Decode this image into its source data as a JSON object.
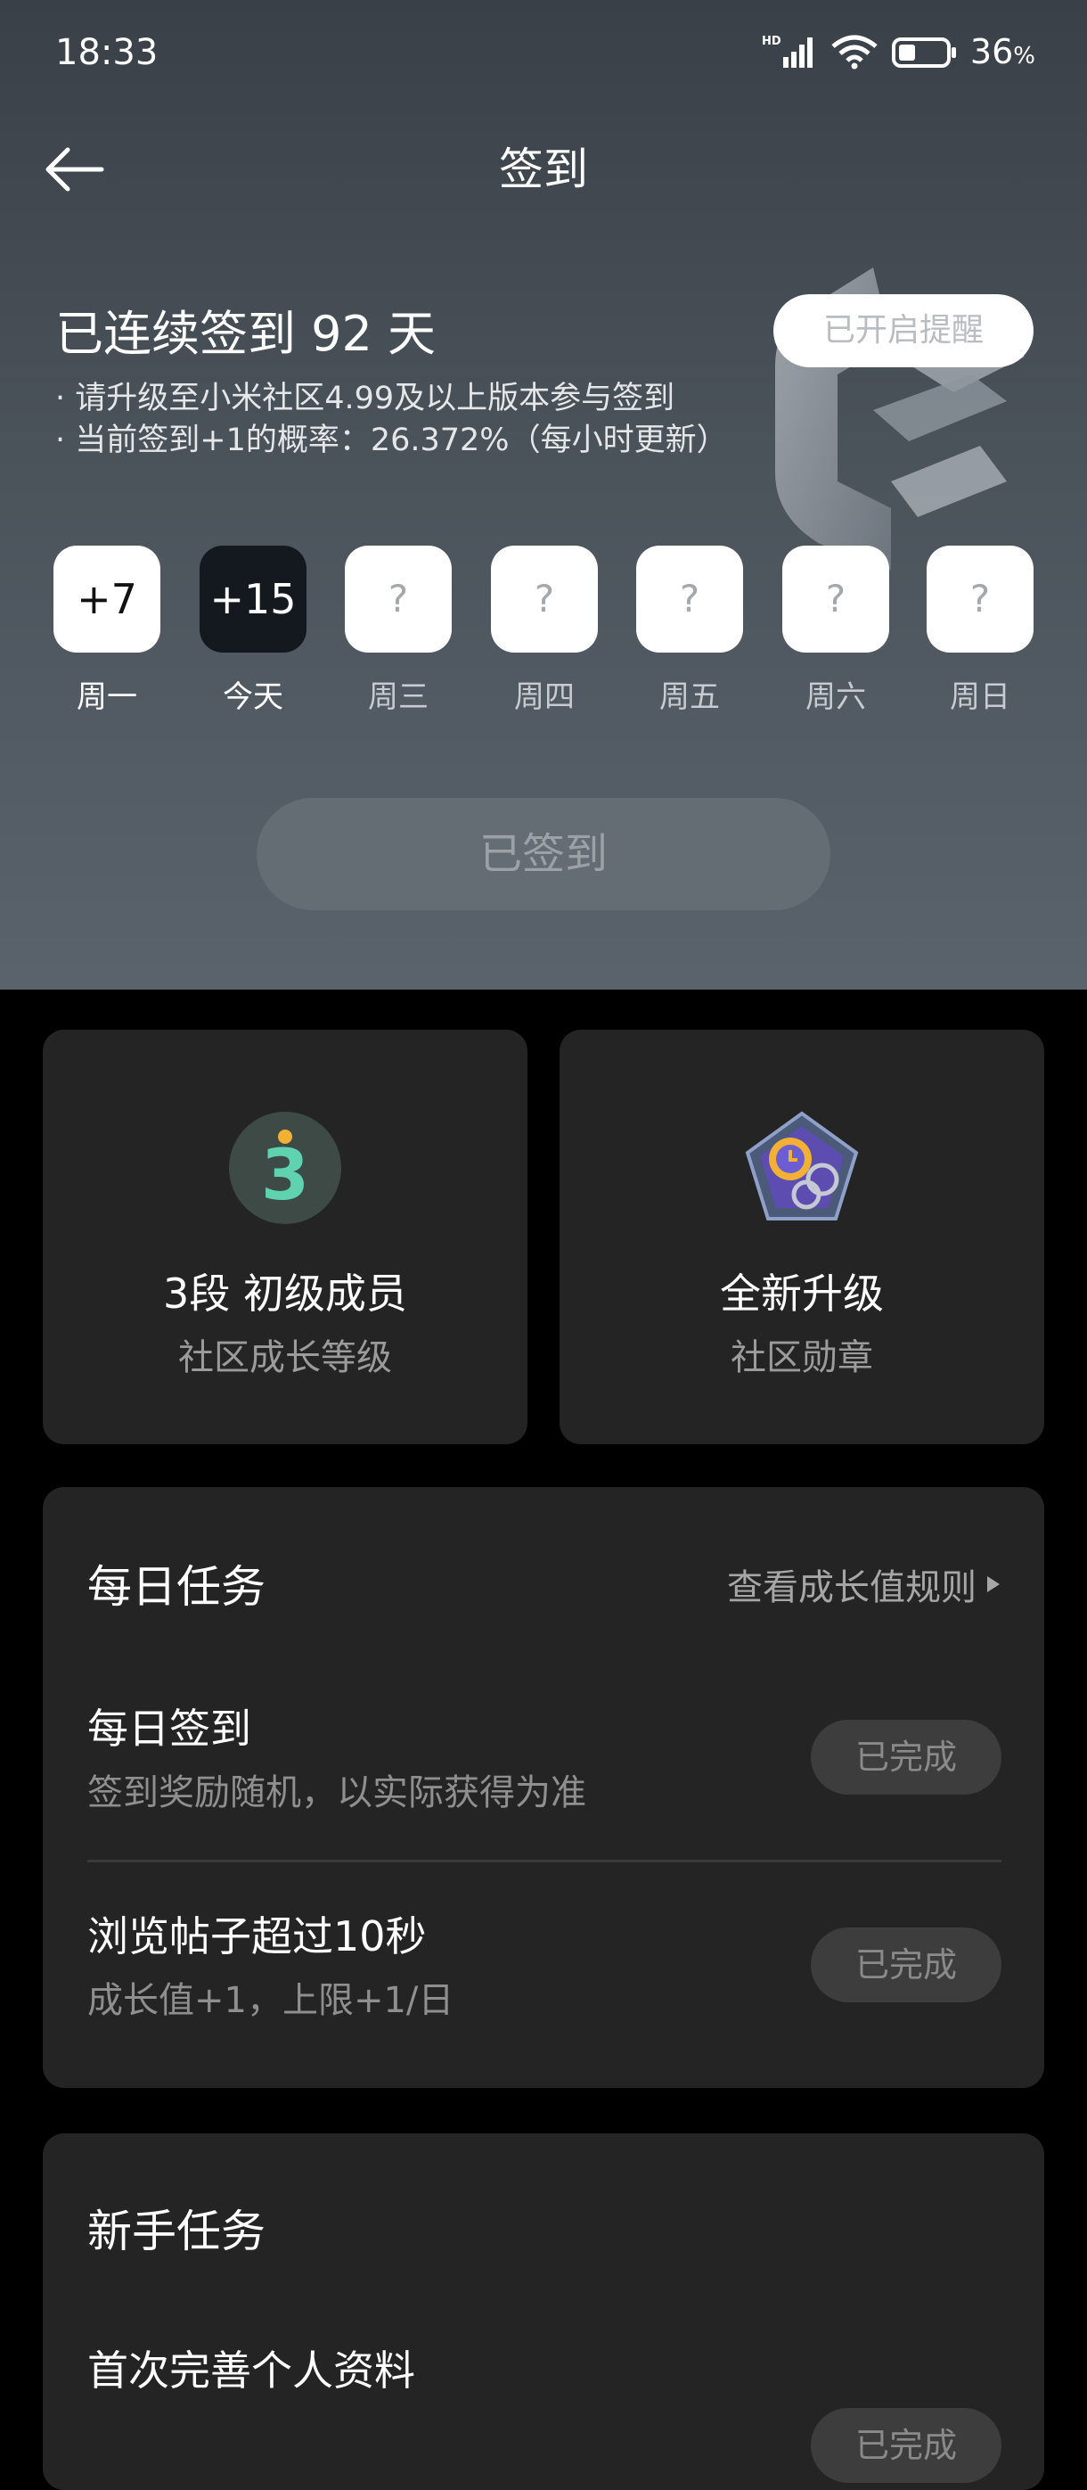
{
  "status_bar": {
    "time": "18:33",
    "network": "HD",
    "battery": "36",
    "battery_unit": "%",
    "battery_level": 0.36
  },
  "header": {
    "title": "签到"
  },
  "checkin": {
    "streak_text": "已连续签到 92 天",
    "reminder_label": "已开启提醒",
    "notes": [
      "· 请升级至小米社区4.99及以上版本参与签到",
      "· 当前签到+1的概率：26.372%（每小时更新）"
    ],
    "days": [
      {
        "value": "+7",
        "label": "周一"
      },
      {
        "value": "+15",
        "label": "今天"
      },
      {
        "value": "?",
        "label": "周三"
      },
      {
        "value": "?",
        "label": "周四"
      },
      {
        "value": "?",
        "label": "周五"
      },
      {
        "value": "?",
        "label": "周六"
      },
      {
        "value": "?",
        "label": "周日"
      }
    ],
    "signed_button": "已签到"
  },
  "level_card": {
    "level_glyph": "3",
    "main": "3段 初级成员",
    "sub": "社区成长等级"
  },
  "badge_card": {
    "main": "全新升级",
    "sub": "社区勋章"
  },
  "daily_tasks": {
    "title": "每日任务",
    "rule_link": "查看成长值规则",
    "tasks": [
      {
        "title": "每日签到",
        "subtitle": "签到奖励随机，以实际获得为准",
        "status": "已完成"
      },
      {
        "title": "浏览帖子超过10秒",
        "subtitle": "成长值+1，上限+1/日",
        "status": "已完成"
      }
    ]
  },
  "newbie_tasks": {
    "title": "新手任务",
    "tasks": [
      {
        "title": "首次完善个人资料",
        "status": "已完成"
      }
    ]
  },
  "colors": {
    "hero_bg": "#4a525a",
    "card_bg": "#242424",
    "level_green": "#5fd3b0",
    "level_circle": "#3d4a46"
  }
}
